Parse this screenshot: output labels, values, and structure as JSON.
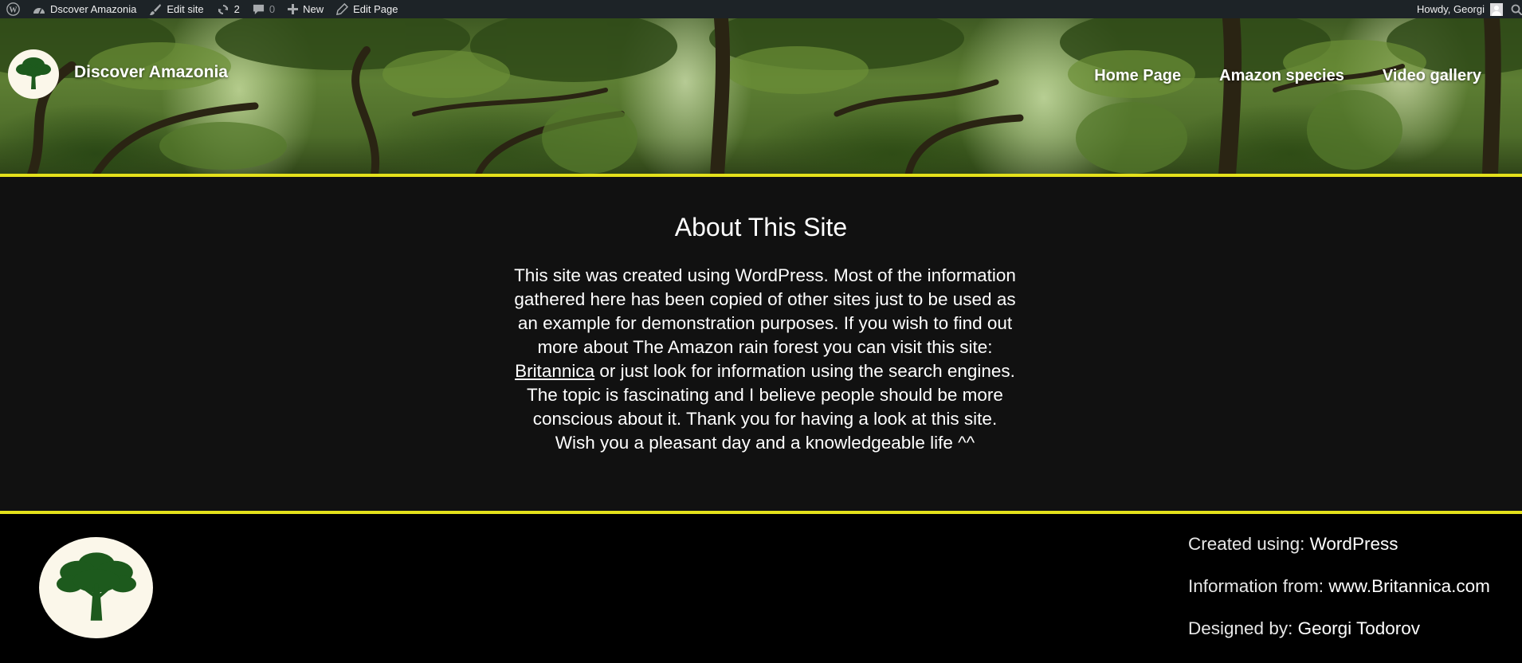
{
  "adminbar": {
    "site_name": "Dscover Amazonia",
    "edit_site": "Edit site",
    "updates_count": "2",
    "comments_count": "0",
    "new_label": "New",
    "edit_page": "Edit Page",
    "howdy": "Howdy, Georgi"
  },
  "header": {
    "site_title": "Discover Amazonia",
    "nav": [
      "Home Page",
      "Amazon species",
      "Video gallery"
    ],
    "accent_color": "#e4e11b"
  },
  "main": {
    "title": "About This Site",
    "text_before_link": "This site was created using WordPress. Most of the information gathered here has been copied of other sites just to be used as an example for demonstration purposes. If you wish to find out more about The Amazon rain forest you can visit this site: ",
    "link_text": "Britannica",
    "text_after_link": " or just look for information using the search engines. The topic is fascinating and I believe people should be more conscious about it. Thank you for having a look at this site. Wish you a pleasant day and a knowledgeable life ^^"
  },
  "footer": {
    "credits": [
      {
        "label": "Created using: ",
        "value": "WordPress"
      },
      {
        "label": "Information from: ",
        "value": "www.Britannica.com"
      },
      {
        "label": "Designed by: ",
        "value": "Georgi Todorov"
      }
    ]
  }
}
